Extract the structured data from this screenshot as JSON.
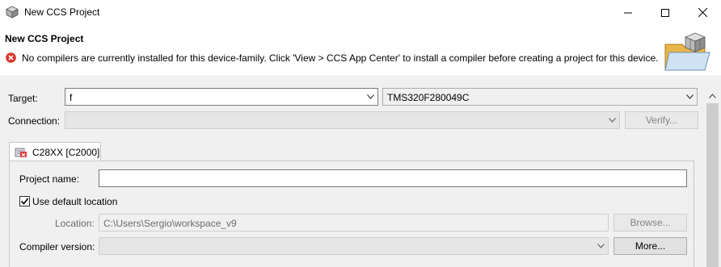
{
  "window": {
    "title": "New CCS Project"
  },
  "header": {
    "title": "New CCS Project",
    "error_message": "No compilers are currently installed for this device-family. Click 'View > CCS App Center' to install a compiler before creating a project for this device."
  },
  "form": {
    "target_label": "Target:",
    "target_family_value": "f",
    "target_device_value": "TMS320F280049C",
    "connection_label": "Connection:",
    "connection_value": "",
    "verify_label": "Verify..."
  },
  "tab": {
    "label": "C28XX [C2000]"
  },
  "panel": {
    "project_name_label": "Project name:",
    "project_name_value": "",
    "use_default_location_label": "Use default location",
    "use_default_location_checked": true,
    "location_label": "Location:",
    "location_value": "C:\\Users\\Sergio\\workspace_v9",
    "browse_label": "Browse...",
    "compiler_version_label": "Compiler version:",
    "compiler_version_value": "",
    "more_label": "More..."
  },
  "colors": {
    "error": "#d9352c",
    "content_bg": "#f0f0f0"
  },
  "icons": {
    "app": "ccs-cube-icon",
    "error": "error-circle-icon",
    "wizard": "folder-cube-wizard-icon",
    "tab": "c28xx-chip-icon"
  }
}
